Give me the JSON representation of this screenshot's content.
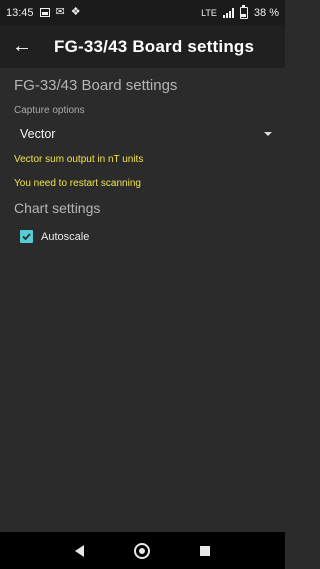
{
  "status_bar": {
    "time": "13:45",
    "network": "LTE",
    "battery": "38 %"
  },
  "app_bar": {
    "title": "FG-33/43 Board settings",
    "back_icon": "arrow-back-icon"
  },
  "content": {
    "screen_title": "FG-33/43 Board settings",
    "capture_label": "Capture options",
    "capture_value": "Vector",
    "info_text": "Vector sum output in nT units",
    "restart_text": "You need to restart scanning",
    "chart_settings": "Chart settings",
    "autoscale_label": "Autoscale",
    "autoscale_checked": true
  },
  "colors": {
    "accent": "#55cbd5",
    "warning": "#f3e24c",
    "background": "#2b2b2b",
    "app_bar": "#202020"
  }
}
